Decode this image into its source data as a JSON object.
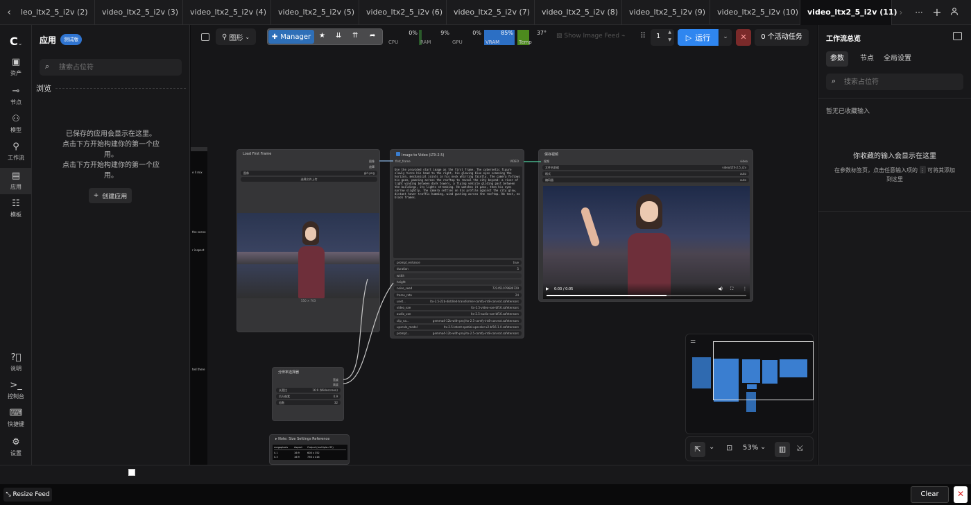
{
  "tabs": [
    {
      "label": "leo_ltx2_5_i2v (2)"
    },
    {
      "label": "video_ltx2_5_i2v (3)"
    },
    {
      "label": "video_ltx2_5_i2v (4)"
    },
    {
      "label": "video_ltx2_5_i2v (5)"
    },
    {
      "label": "video_ltx2_5_i2v (6)"
    },
    {
      "label": "video_ltx2_5_i2v (7)"
    },
    {
      "label": "video_ltx2_5_i2v (8)"
    },
    {
      "label": "video_ltx2_5_i2v (9)"
    },
    {
      "label": "video_ltx2_5_i2v (10)"
    },
    {
      "label": "video_ltx2_5_i2v (11)"
    }
  ],
  "tab_controls": {
    "more": "···",
    "new": "+"
  },
  "rail": {
    "assets": "资产",
    "nodes": "节点",
    "models": "模型",
    "workflows": "工作流",
    "apps": "应用",
    "templates": "模板",
    "help": "说明",
    "console": "控制台",
    "shortcuts": "快捷键",
    "settings": "设置"
  },
  "apps_panel": {
    "title": "应用",
    "badge": "测试版",
    "search_placeholder": "搜索占位符",
    "browse": "浏览",
    "empty_line1": "已保存的应用会显示在这里。",
    "empty_line2": "点击下方开始构建你的第一个应",
    "empty_line3": "用。",
    "empty_line4": "点击下方开始构建你的第一个应",
    "empty_line5": "用。",
    "create_button": "创建应用"
  },
  "toolbar": {
    "graph_label": "图形",
    "manager_label": "Manager",
    "cpu_label": "CPU",
    "cpu_value": "0%",
    "ram_label": "RAM",
    "ram_value": "9%",
    "gpu_label": "GPU",
    "gpu_value": "0%",
    "vram_label": "VRAM",
    "vram_value": "85%",
    "temp_label": "Temp",
    "temp_value": "37°",
    "show_feed": "Show Image Feed",
    "run_count": "1",
    "run_label": "运行",
    "active_tasks": "0 个活动任务"
  },
  "nodes": {
    "load_frame": {
      "title": "Load First Frame",
      "port_image": "图像",
      "port_mask": "遮罩",
      "image_label": "图像",
      "image_value": "girl.png",
      "upload_button": "选择文件上传",
      "dims": "550 × 703"
    },
    "i2v": {
      "title": "Image to Video (LTX-2.5)",
      "first_frame": "first_frame",
      "video_out": "VIDEO",
      "prompt_text": "Use the provided start image as the first frame. The cybernetic figure slowly turns his head to the right, his glowing blue eyes scanning the horizon, mechanical joints in his neck whirring faintly. The camera follows his gaze, panning across the rooftop to reveal the city beyond: a river of light winding between dark towers, a flying vehicle gliding past between the buildings, its lights streaking. He watches it pass, then his eyes narrow slightly. The camera settles on his profile against the city glow, distant hover traffic humming, wind gusting across the rooftop. No text, no black frames.",
      "widgets": [
        {
          "k": "prompt_enhance",
          "v": "true"
        },
        {
          "k": "duration",
          "v": "5"
        },
        {
          "k": "width",
          "v": ""
        },
        {
          "k": "height",
          "v": ""
        },
        {
          "k": "noise_seed",
          "v": "722451079680729"
        },
        {
          "k": "frame_rate",
          "v": "24"
        },
        {
          "k": "unet...",
          "v": "ltx-2.5-22b-distilled-transformer-comfy-int8-convrot.safetensors"
        },
        {
          "k": "video_vae",
          "v": "ltx-2.5-video-vae-bf16.safetensors"
        },
        {
          "k": "audio_vae",
          "v": "ltx-2.5-audio-vae-bf16.safetensors"
        },
        {
          "k": "clip_na...",
          "v": "gemma4-12b-with-proj-ltx-2.5-comfy-int8-convrot.safetensors"
        },
        {
          "k": "upscale_model",
          "v": "ltx-2.5-latent-spatial-upscaler-x2-bf16-1.0.safetensors"
        },
        {
          "k": "prompt...",
          "v": "gemma4-12b-with-proj-ltx-2.5-comfy-int8-convrot.safetensors"
        }
      ]
    },
    "save_video": {
      "title": "保存视频",
      "port_video": "视频",
      "video_out": "video",
      "filename_label": "文件名前缀",
      "filename_value": "video/LTX-2.5_i2v",
      "format_label": "格式",
      "format_value": "auto",
      "codec_label": "编码器",
      "codec_value": "auto",
      "time": "0:03 / 0:05"
    },
    "resolution": {
      "title": "分辨率选择器",
      "out_width": "宽度",
      "out_height": "高度",
      "aspect_label": "长宽比",
      "aspect_value": "16:9 (Widescreen)",
      "mp_label": "百万像素",
      "mp_value": "0.9",
      "mult_label": "倍数",
      "mult_value": "32"
    },
    "note": {
      "title": "Note: Size Settings Reference",
      "headers": [
        "megapixels",
        "Aspect",
        "Output (multiple=32)"
      ],
      "rows": [
        [
          "0.1",
          "16:9",
          "608 x 352"
        ],
        [
          "0.3",
          "16:9",
          "736 x 416"
        ]
      ]
    },
    "cut_labels": [
      "e ll mix",
      "the scene",
      "r inspect",
      "ted there"
    ]
  },
  "zoom": {
    "value": "53%"
  },
  "right_panel": {
    "title": "工作流总览",
    "tab_params": "参数",
    "tab_nodes": "节点",
    "tab_global": "全局设置",
    "search_placeholder": "搜索占位符",
    "no_fav": "暂无已收藏输入",
    "fav_title": "你收藏的输入会显示在这里",
    "fav_desc_1": "在参数标签页，点击任意输入项的",
    "fav_desc_2": "可将其添加",
    "fav_desc_3": "到这里"
  },
  "bottom": {
    "resize_feed": "Resize Feed",
    "clear": "Clear"
  }
}
